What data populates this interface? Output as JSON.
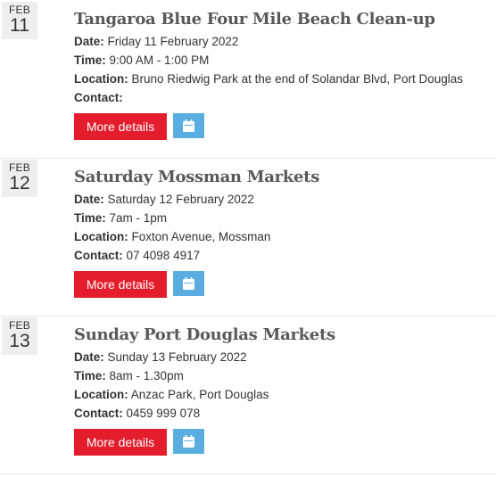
{
  "labels": {
    "date": "Date:",
    "time": "Time:",
    "location": "Location:",
    "contact": "Contact:"
  },
  "events": [
    {
      "month": "FEB",
      "day": "11",
      "title": "Tangaroa Blue Four Mile Beach Clean-up",
      "date": "Friday 11 February 2022",
      "time": "9:00 AM - 1:00 PM",
      "location": "Bruno Riedwig Park at the end of Solandar Blvd, Port Douglas",
      "contact": "",
      "more_label": "More details",
      "calendar_icon": "calendar-icon"
    },
    {
      "month": "FEB",
      "day": "12",
      "title": "Saturday Mossman Markets",
      "date": "Saturday 12 February 2022",
      "time": "7am - 1pm",
      "location": "Foxton Avenue, Mossman",
      "contact": "07 4098 4917",
      "more_label": "More details",
      "calendar_icon": "calendar-icon"
    },
    {
      "month": "FEB",
      "day": "13",
      "title": "Sunday Port Douglas Markets",
      "date": "Sunday 13 February 2022",
      "time": "8am - 1.30pm",
      "location": "Anzac Park, Port Douglas",
      "contact": "0459 999 078",
      "more_label": "More details",
      "calendar_icon": "calendar-icon"
    }
  ],
  "colors": {
    "more_button": "#e41d2d",
    "calendar_button": "#5aade0",
    "title": "#595959",
    "date_badge": "#eeeeee"
  }
}
